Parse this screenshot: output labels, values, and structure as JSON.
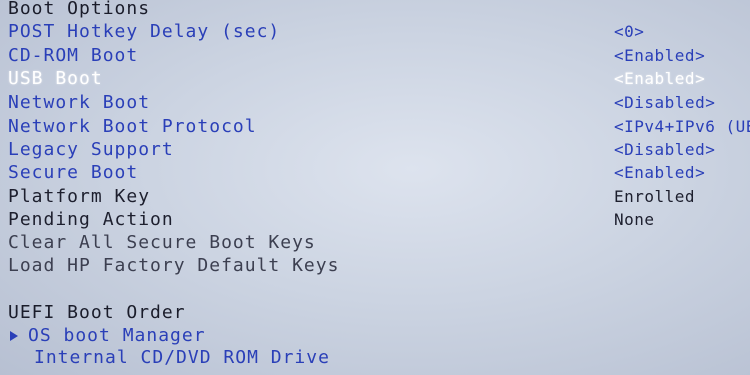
{
  "section": {
    "title": "Boot Options"
  },
  "options": [
    {
      "label": "POST Hotkey Delay (sec)",
      "value": "<0>"
    },
    {
      "label": "CD-ROM Boot",
      "value": "<Enabled>"
    },
    {
      "label": "USB Boot",
      "value": "<Enabled>"
    },
    {
      "label": "Network Boot",
      "value": "<Disabled>"
    },
    {
      "label": "Network Boot Protocol",
      "value": "<IPv4+IPv6 (UE"
    },
    {
      "label": "Legacy Support",
      "value": "<Disabled>"
    },
    {
      "label": "Secure Boot",
      "value": "<Enabled>"
    },
    {
      "label": "Platform Key",
      "value": "Enrolled"
    },
    {
      "label": "Pending Action",
      "value": "None"
    },
    {
      "label": "Clear All Secure Boot Keys",
      "value": ""
    },
    {
      "label": "Load HP Factory Default Keys",
      "value": ""
    }
  ],
  "uefi_order": {
    "title": "UEFI Boot Order",
    "items": [
      {
        "label": "OS boot Manager"
      },
      {
        "label": "Internal CD/DVD ROM Drive"
      }
    ]
  },
  "colors": {
    "background": "#ccd4e2",
    "option_text": "#2a3fb8",
    "static_text": "#1d1f2e",
    "selected_text": "#ffffff"
  }
}
